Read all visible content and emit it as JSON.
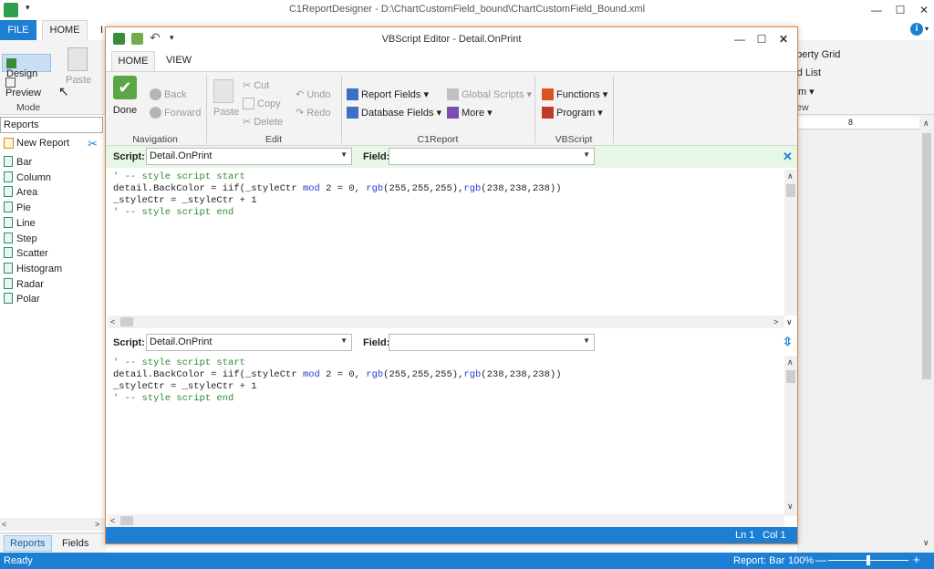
{
  "app": {
    "title": "C1ReportDesigner - D:\\ChartCustomField_bound\\ChartCustomField_Bound.xml",
    "tab_file": "FILE",
    "tab_home": "HOME",
    "tab_partial": "I",
    "design_label": "Design",
    "preview_label": "Preview",
    "paste_label": "Paste",
    "mode_label": "Mode",
    "property_grid_label": "Property Grid",
    "field_list_label": "Field List",
    "zoom_label": "Zoom",
    "view_label": "View"
  },
  "left_panel": {
    "combo_value": "Reports",
    "new_report_label": "New Report",
    "reports": [
      "Bar",
      "Column",
      "Area",
      "Pie",
      "Line",
      "Step",
      "Scatter",
      "Histogram",
      "Radar",
      "Polar"
    ],
    "tab_reports": "Reports",
    "tab_fields": "Fields"
  },
  "statusbar": {
    "left_text": "Ready",
    "report_text": "Report: Bar",
    "zoom_text": "100%"
  },
  "editor": {
    "title": "VBScript Editor - Detail.OnPrint",
    "tab_home": "HOME",
    "tab_view": "VIEW",
    "done_label": "Done",
    "back_label": "Back",
    "forward_label": "Forward",
    "navigation_label": "Navigation",
    "paste_label": "Paste",
    "cut_label": "Cut",
    "copy_label": "Copy",
    "delete_label": "Delete",
    "undo_label": "Undo",
    "redo_label": "Redo",
    "edit_label": "Edit",
    "report_fields_label": "Report Fields",
    "database_fields_label": "Database Fields",
    "global_scripts_label": "Global Scripts",
    "more_label": "More",
    "c1report_label": "C1Report",
    "functions_label": "Functions",
    "program_label": "Program",
    "vbscript_label": "VBScript",
    "script_label": "Script:",
    "script_value": "Detail.OnPrint",
    "field_label": "Field:",
    "field_value": "",
    "code": {
      "line1": "' -- style script start",
      "line2_a": "detail.BackColor = iif(_styleCtr ",
      "line2_kw1": "mod",
      "line2_b": " 2 = 0, ",
      "line2_kw2": "rgb",
      "line2_c": "(255,255,255),",
      "line2_kw3": "rgb",
      "line2_d": "(238,238,238))",
      "line3": "_styleCtr = _styleCtr + 1",
      "line4": "' -- style script end"
    },
    "status_ln": "Ln 1",
    "status_col": "Col 1"
  }
}
